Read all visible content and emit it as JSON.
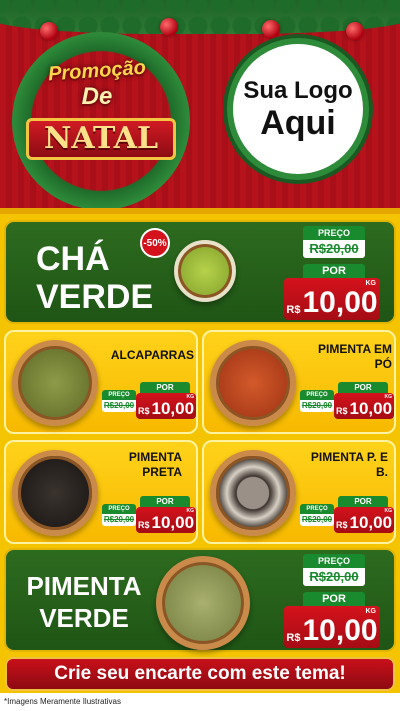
{
  "header": {
    "promo_line1": "Promoção",
    "promo_line2": "De",
    "promo_natal": "NATAL",
    "logo_line1": "Sua Logo",
    "logo_line2": "Aqui"
  },
  "products": [
    {
      "name": "CHÁ VERDE",
      "badge": "-50%",
      "preco_label": "PREÇO",
      "old_price": "R$20,00",
      "por_label": "POR",
      "currency": "R$",
      "price": "10,00",
      "unit": "KG",
      "color": "#9cbf3a"
    },
    {
      "name": "ALCAPARRAS",
      "preco_label": "PREÇO",
      "old_price": "R$20,00",
      "por_label": "POR",
      "currency": "R$",
      "price": "10,00",
      "unit": "KG",
      "color": "#7a8a3a"
    },
    {
      "name": "PIMENTA EM PÓ",
      "preco_label": "PREÇO",
      "old_price": "R$20,00",
      "por_label": "POR",
      "currency": "R$",
      "price": "10,00",
      "unit": "KG",
      "color": "#c0451e"
    },
    {
      "name": "PIMENTA PRETA",
      "preco_label": "PREÇO",
      "old_price": "R$20,00",
      "por_label": "POR",
      "currency": "R$",
      "price": "10,00",
      "unit": "KG",
      "color": "#2a2522"
    },
    {
      "name": "PIMENTA P. E B.",
      "preco_label": "PREÇO",
      "old_price": "R$20,00",
      "por_label": "POR",
      "currency": "R$",
      "price": "10,00",
      "unit": "KG",
      "color": "#8a8078"
    },
    {
      "name": "PIMENTA VERDE",
      "preco_label": "PREÇO",
      "old_price": "R$20,00",
      "por_label": "POR",
      "currency": "R$",
      "price": "10,00",
      "unit": "KG",
      "color": "#8f9a5a"
    }
  ],
  "banner_text": "Crie seu encarte com este tema!",
  "footnote": "*Imagens Meramente Ilustrativas"
}
